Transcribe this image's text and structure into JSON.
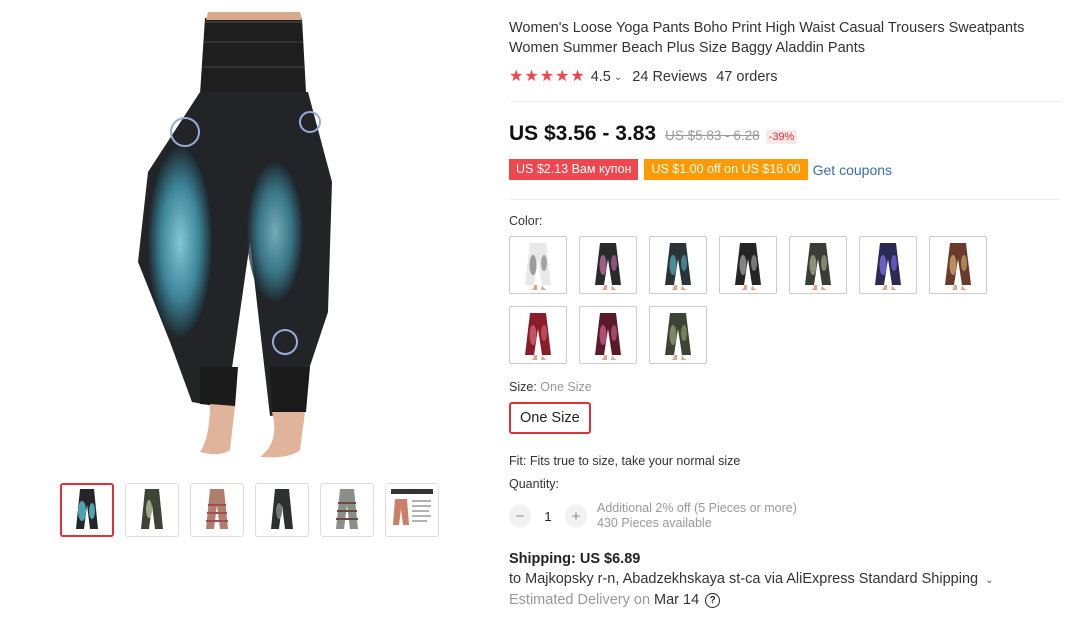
{
  "product": {
    "title": "Women's Loose Yoga Pants Boho Print High Waist Casual Trousers Sweatpants Women Summer Beach Plus Size Baggy Aladdin Pants",
    "rating": "4.5",
    "reviews": "24 Reviews",
    "orders": "47 orders",
    "price": "US $3.56 - 3.83",
    "old_price": "US $5.83 - 6.28",
    "discount": "-39%"
  },
  "coupons": {
    "coupon1": "US $2.13 Вам купон",
    "coupon2": "US $1.00 off on US $16.00",
    "get_coupons": "Get coupons"
  },
  "color": {
    "label": "Color:",
    "swatches": [
      {
        "base": "#e8e8e8",
        "accent": "#888888"
      },
      {
        "base": "#2a2a2a",
        "accent": "#b56aa0"
      },
      {
        "base": "#2a3438",
        "accent": "#4fa3b0"
      },
      {
        "base": "#252525",
        "accent": "#9a9a9a"
      },
      {
        "base": "#3a3d35",
        "accent": "#a0a58a"
      },
      {
        "base": "#2b2a55",
        "accent": "#7a6adf"
      },
      {
        "base": "#6b3a2a",
        "accent": "#c9a36a"
      },
      {
        "base": "#8a1d2a",
        "accent": "#d06070"
      },
      {
        "base": "#5a1a2a",
        "accent": "#c05a8a"
      },
      {
        "base": "#3d4436",
        "accent": "#8a9a6a"
      }
    ]
  },
  "size": {
    "label": "Size:",
    "selected": "One Size",
    "option": "One Size"
  },
  "fit": "Fit: Fits true to size, take your normal size",
  "quantity": {
    "label": "Quantity:",
    "value": "1",
    "minus": "−",
    "plus": "+",
    "note1": "Additional 2% off (5 Pieces or more)",
    "note2": "430 Pieces available"
  },
  "shipping": {
    "cost": "Shipping: US $6.89",
    "to": "to Majkopsky r-n, Abadzekhskaya st-ca via AliExpress Standard Shipping",
    "estimated_label": "Estimated Delivery on",
    "date": "Mar 14"
  },
  "icons": {
    "star": "★",
    "chevron": "⌄",
    "help": "?"
  },
  "colors": {
    "accent_red": "#e0303a",
    "coupon_red": "#f0464d",
    "coupon_orange": "#ff9a00",
    "link_blue": "#3c6ea1"
  }
}
